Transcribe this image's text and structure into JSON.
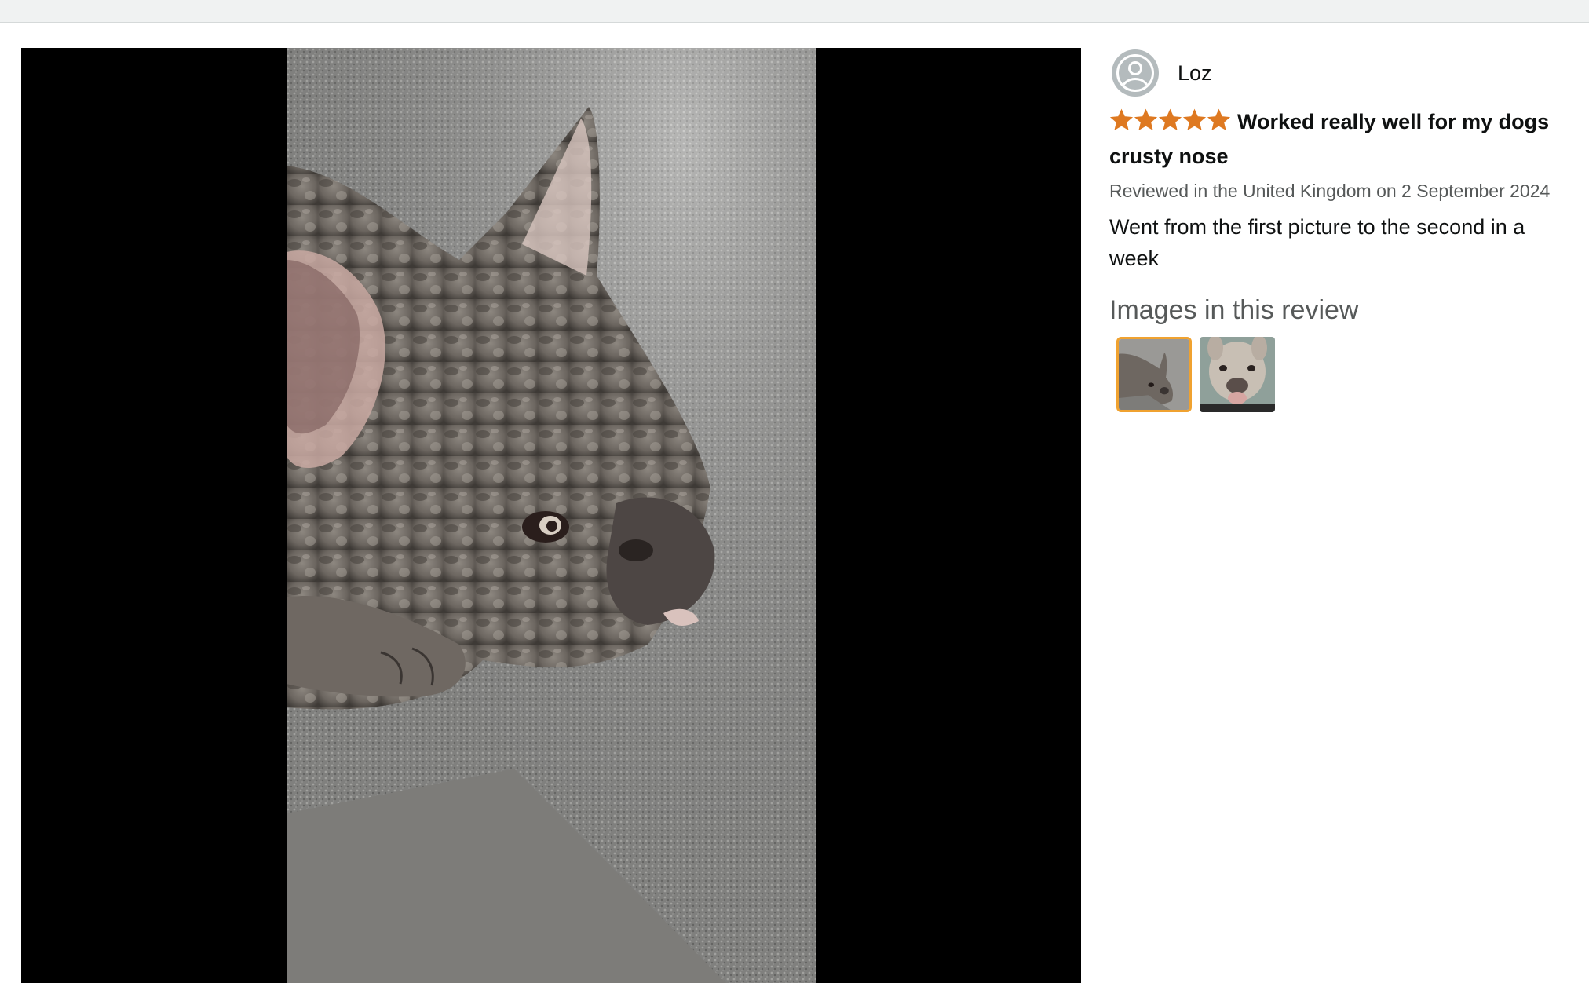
{
  "review": {
    "reviewer_name": "Loz",
    "rating": 5,
    "rating_max": 5,
    "title": "Worked really well for my dogs crusty nose",
    "date_text": "Reviewed in the United Kingdom on 2 September 2024",
    "body": "Went from the first picture to the second in a week"
  },
  "images_section": {
    "heading": "Images in this review",
    "thumbnails": [
      {
        "icon": "dog-photo-thumbnail",
        "selected": true
      },
      {
        "icon": "dog-photo-thumbnail",
        "selected": false
      }
    ]
  },
  "colors": {
    "star": "#de7921",
    "selected_border": "#f0a230",
    "viewer_background": "#000000"
  }
}
